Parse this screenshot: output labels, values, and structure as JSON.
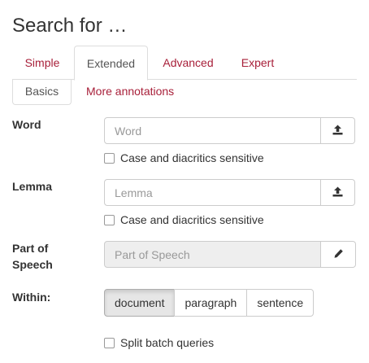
{
  "page": {
    "title": "Search for …"
  },
  "tabs": [
    {
      "label": "Simple",
      "active": false
    },
    {
      "label": "Extended",
      "active": true
    },
    {
      "label": "Advanced",
      "active": false
    },
    {
      "label": "Expert",
      "active": false
    }
  ],
  "subtabs": [
    {
      "label": "Basics",
      "active": true
    },
    {
      "label": "More annotations",
      "active": false
    }
  ],
  "form": {
    "word": {
      "label": "Word",
      "placeholder": "Word",
      "value": "",
      "button_icon": "upload-icon",
      "checkbox_label": "Case and diacritics sensitive",
      "checked": false
    },
    "lemma": {
      "label": "Lemma",
      "placeholder": "Lemma",
      "value": "",
      "button_icon": "upload-icon",
      "checkbox_label": "Case and diacritics sensitive",
      "checked": false
    },
    "pos": {
      "label_line1": "Part of",
      "label_line2": "Speech",
      "placeholder": "Part of Speech",
      "disabled": true,
      "button_icon": "pencil-icon"
    },
    "within": {
      "label": "Within:",
      "options": [
        "document",
        "paragraph",
        "sentence"
      ],
      "selected": "document"
    },
    "split": {
      "label": "Split batch queries",
      "checked": false
    }
  },
  "colors": {
    "link": "#a8203a",
    "border": "#dddddd",
    "disabled_bg": "#eeeeee"
  }
}
